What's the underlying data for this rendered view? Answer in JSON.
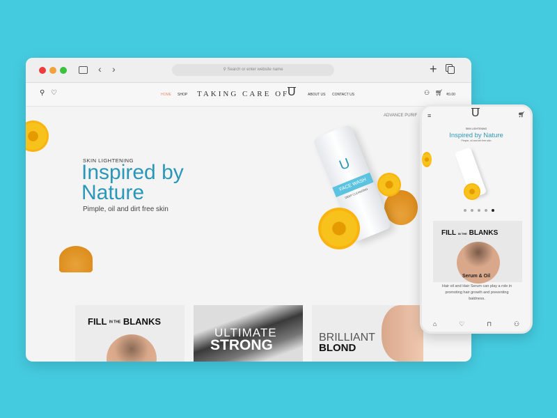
{
  "browser": {
    "url_placeholder": "Search or enter website name",
    "icons": [
      "sidebar-icon",
      "back-icon",
      "forward-icon",
      "search-icon",
      "plus-icon",
      "tabs-icon"
    ],
    "traffic": [
      "#ec3d3d",
      "#f2a23a",
      "#3cc13f"
    ]
  },
  "nav": {
    "items": [
      {
        "label": "HOME",
        "active": true
      },
      {
        "label": "SHOP"
      },
      {
        "label": "ABOUT US"
      },
      {
        "label": "CONTACT US"
      }
    ],
    "brand": "TAKING CARE OF",
    "logo": "U",
    "cart_total": "₹0.00",
    "cart_count": "0"
  },
  "hero": {
    "eyebrow": "SKIN LIGHTENING",
    "title_line1": "Inspired by",
    "title_line2": "Nature",
    "subtitle": "Pimple, oil and dirt free skin",
    "side_text": "ADVANCE PURIF",
    "product": {
      "name": "FACE WASH",
      "tag": "DEEP CLEANSING"
    }
  },
  "cards": [
    {
      "title_a": "FILL",
      "title_mid": "IN THE",
      "title_b": "BLANKS"
    },
    {
      "title_a": "ULTIMATE",
      "title_b": "STRONG"
    },
    {
      "title_a": "BRILLIANT",
      "title_b": "BLOND"
    }
  ],
  "phone": {
    "eyebrow": "SKIN LIGHTENING",
    "title": "Inspired by Nature",
    "subtitle": "Pimple, oil and dirt free skin",
    "card_title_a": "FILL",
    "card_title_mid": "IN THE",
    "card_title_b": "BLANKS",
    "card_heading": "Serum & Oil",
    "card_text": "Hair oil and Hair Serum can play a role in promoting hair growth and preventing baldness.",
    "slides": 5,
    "active_slide": 5
  },
  "colors": {
    "background": "#45cbe0",
    "accent": "#2a97b8",
    "nav_active": "#e98c6a"
  }
}
